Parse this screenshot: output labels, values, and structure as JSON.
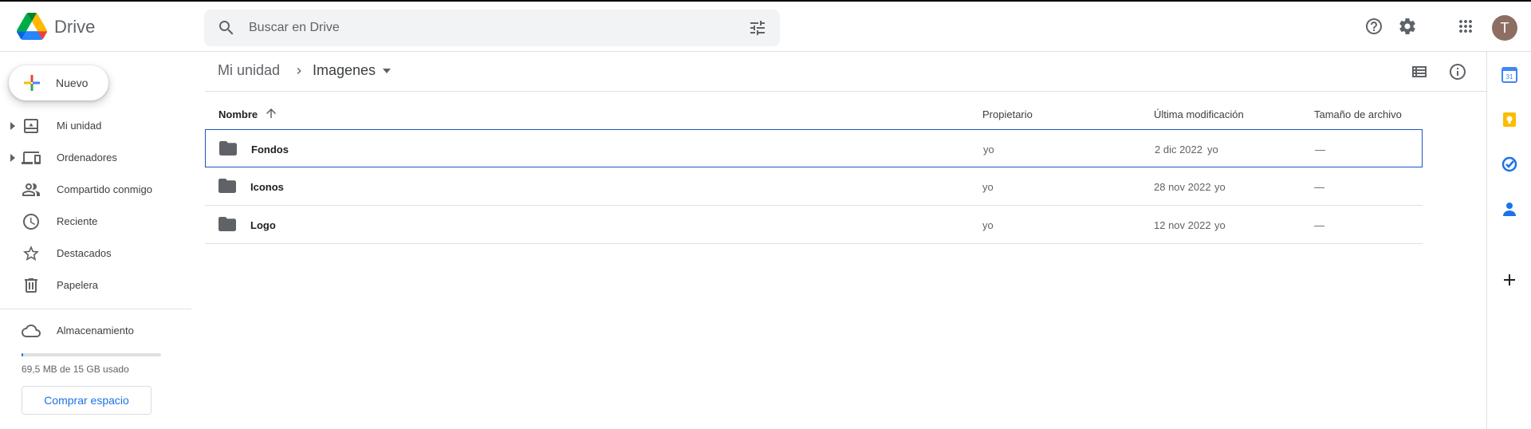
{
  "app": {
    "name": "Drive"
  },
  "search": {
    "placeholder": "Buscar en Drive"
  },
  "avatar": {
    "initial": "T",
    "color": "#8d6e63"
  },
  "sidebar": {
    "new_label": "Nuevo",
    "items": [
      {
        "label": "Mi unidad",
        "icon": "my-drive-icon",
        "expandable": true
      },
      {
        "label": "Ordenadores",
        "icon": "computers-icon",
        "expandable": true
      },
      {
        "label": "Compartido conmigo",
        "icon": "shared-icon",
        "expandable": false
      },
      {
        "label": "Reciente",
        "icon": "clock-icon",
        "expandable": false
      },
      {
        "label": "Destacados",
        "icon": "star-icon",
        "expandable": false
      },
      {
        "label": "Papelera",
        "icon": "trash-icon",
        "expandable": false
      }
    ],
    "storage": {
      "label": "Almacenamiento",
      "usage_text": "69,5 MB de 15 GB usado",
      "used_fraction": 0.0046,
      "buy_label": "Comprar espacio"
    }
  },
  "breadcrumb": {
    "root": "Mi unidad",
    "current": "Imagenes"
  },
  "table": {
    "headers": {
      "name": "Nombre",
      "owner": "Propietario",
      "modified": "Última modificación",
      "size": "Tamaño de archivo"
    },
    "rows": [
      {
        "name": "Fondos",
        "owner": "yo",
        "modified": "2 dic 2022",
        "modified_by": "yo",
        "size": "—",
        "selected": true
      },
      {
        "name": "Iconos",
        "owner": "yo",
        "modified": "28 nov 2022",
        "modified_by": "yo",
        "size": "—",
        "selected": false
      },
      {
        "name": "Logo",
        "owner": "yo",
        "modified": "12 nov 2022",
        "modified_by": "yo",
        "size": "—",
        "selected": false
      }
    ]
  },
  "colors": {
    "accent": "#1a73e8",
    "selection_border": "#1a56c4",
    "folder": "#5f6368"
  }
}
